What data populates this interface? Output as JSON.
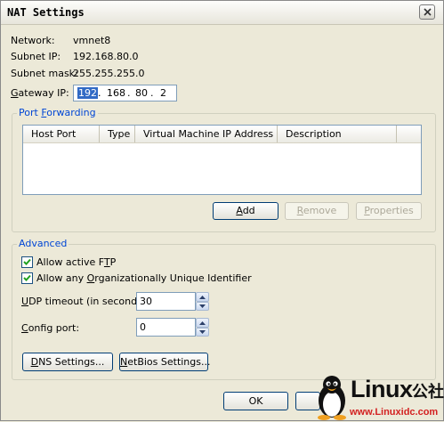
{
  "window": {
    "title": "NAT Settings",
    "close_icon": "close-icon"
  },
  "info": {
    "network_label": "Network:",
    "network_value": "vmnet8",
    "subnet_ip_label": "Subnet IP:",
    "subnet_ip_value": "192.168.80.0",
    "subnet_mask_label": "Subnet mask:",
    "subnet_mask_value": "255.255.255.0"
  },
  "gateway": {
    "label_pre": "",
    "label_u": "G",
    "label_post": "ateway IP:",
    "seg1": "192",
    "seg2": "168",
    "seg3": "80",
    "seg4": "2"
  },
  "port_forwarding": {
    "title_pre": "Port ",
    "title_u": "F",
    "title_post": "orwarding",
    "columns": [
      "Host Port",
      "Type",
      "Virtual Machine IP Address",
      "Description"
    ],
    "add_u": "A",
    "add_rest": "dd",
    "remove_u": "R",
    "remove_rest": "emove",
    "properties_u": "P",
    "properties_rest": "roperties"
  },
  "advanced": {
    "title": "Advanced",
    "allow_ftp_pre": "Allow active F",
    "allow_ftp_u": "T",
    "allow_ftp_post": "P",
    "allow_ftp_checked": true,
    "allow_oui_pre": "Allow any ",
    "allow_oui_u": "O",
    "allow_oui_post": "rganizationally Unique Identifier",
    "allow_oui_checked": true,
    "udp_label_u": "U",
    "udp_label_rest": "DP timeout (in seconds):",
    "udp_value": "30",
    "config_label_u": "C",
    "config_label_rest": "onfig port:",
    "config_value": "0",
    "dns_u": "D",
    "dns_rest": "NS Settings...",
    "netbios_u": "N",
    "netbios_rest": "etBios Settings..."
  },
  "footer": {
    "ok": "OK"
  },
  "watermark": {
    "brand": "Linux",
    "cn": "公社",
    "url": "www.Linuxidc.com"
  },
  "colors": {
    "group_title": "#0046d5",
    "selection": "#316ac5",
    "dialog_bg": "#ece9d8"
  }
}
